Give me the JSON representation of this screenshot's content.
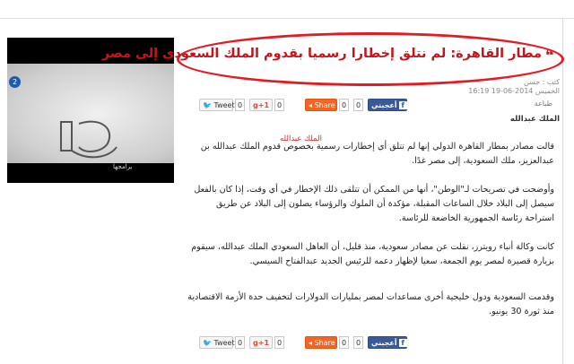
{
  "video": {
    "badge": "2",
    "caption": "برامجها"
  },
  "article": {
    "title": "مطار القاهرة: لم نتلق إخطارا رسميا بقدوم الملك السعودي إلى مصر",
    "author": "كتب : حسن",
    "date": "الخميس 2014-06-19 16:19",
    "print": "طباعة",
    "tag": "الملك عبدالله",
    "subhead": "الملك عبدالله",
    "paragraphs": [
      "قالت مصادر بمطار القاهرة الدولي إنها لم تتلق أي إخطارات رسمية بخصوص قدوم الملك عبدالله بن عبدالعزيز، ملك السعودية، إلى مصر غدًا.",
      "وأوضحت في تصريحات لـ\"الوطن\"، أنها من الممكن أن تتلقى ذلك الإخطار في أي وقت، إذا كان بالفعل سيصل إلى البلاد خلال الساعات المقبلة، مؤكدة أن الملوك والرؤساء يصلون إلى البلاد عن طريق استراحة رئاسة الجمهورية الخاضعة للرئاسة.",
      "كانت وكالة أنباء رويترز، نقلت عن مصادر سعودية، منذ قليل، أن العاهل السعودي الملك عبدالله، سيقوم بزيارة قصيرة لمصر يوم الجمعة، سعيا لإظهار دعمه للرئيس الجديد عبدالفتاح السيسي.",
      "وقدمت السعودية ودول خليجية أخرى مساعدات لمصر بمليارات الدولارات لتخفيف حدة الأزمة الاقتصادية منذ ثورة 30 يونيو."
    ]
  },
  "share": {
    "tweet_label": "Tweet",
    "tweet_count": "0",
    "gplus_label": "+1",
    "gplus_count": "0",
    "share_label": "Share",
    "share_count": "0",
    "like_label": "أعجبني",
    "like_count": "0"
  },
  "colors": {
    "title_red": "#c4151c",
    "highlight_ring": "#e31b23",
    "facebook_blue": "#3b5998",
    "share_orange": "#f26522"
  }
}
